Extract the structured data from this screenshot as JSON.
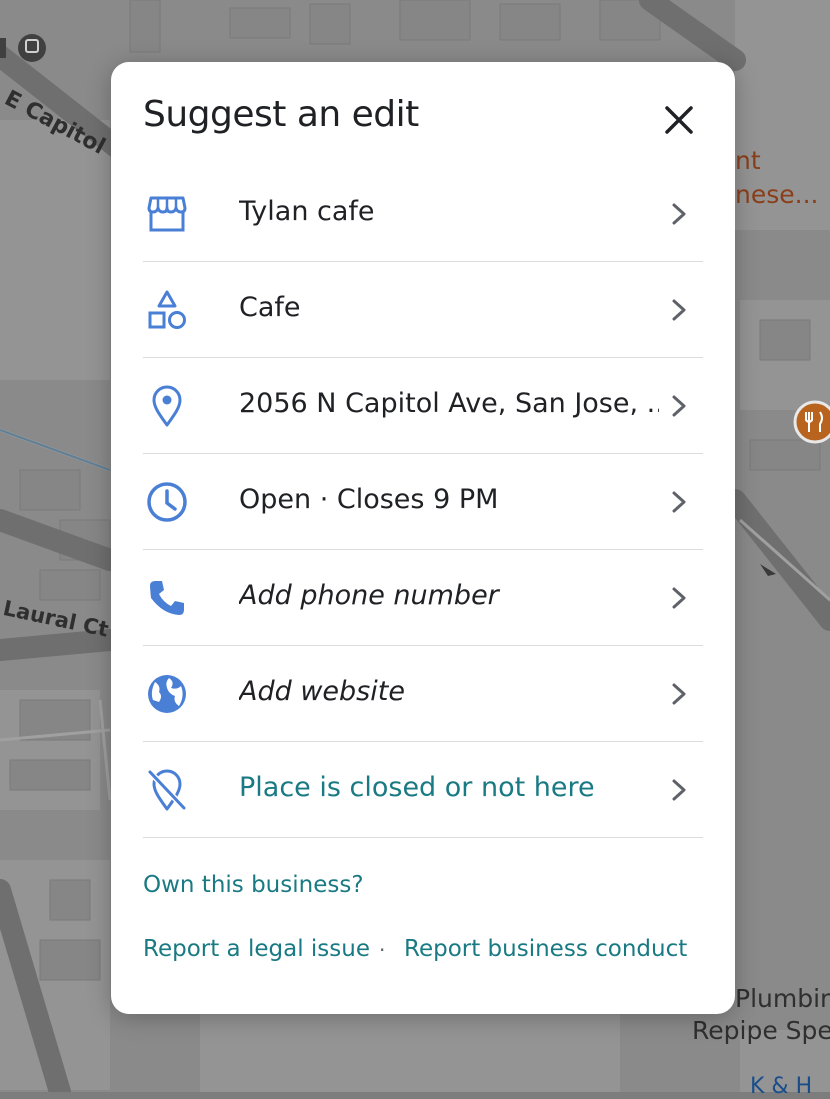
{
  "map": {
    "labels": {
      "street_top": "E Capitol",
      "laural": "Laural Ct",
      "partial_right_1": "nt",
      "partial_right_2": "nese...",
      "plumbing_1": "Plumbin",
      "plumbing_2": "Repipe Spe",
      "partial_bottom": "K & H"
    },
    "icons": {
      "transit": "train-icon",
      "restaurant": "fork-knife-icon"
    }
  },
  "dialog": {
    "title": "Suggest an edit",
    "close_icon": "close-icon",
    "rows": [
      {
        "icon": "storefront-icon",
        "label": "Tylan cafe"
      },
      {
        "icon": "category-shapes-icon",
        "label": "Cafe"
      },
      {
        "icon": "location-pin-icon",
        "label": "2056 N Capitol Ave, San Jose, ..."
      },
      {
        "icon": "clock-icon",
        "label": "Open · Closes 9 PM"
      },
      {
        "icon": "phone-icon",
        "label": "Add phone number"
      },
      {
        "icon": "globe-icon",
        "label": "Add website"
      },
      {
        "icon": "location-off-icon",
        "label": "Place is closed or not here"
      }
    ],
    "links": {
      "own_business": "Own this business?",
      "report_legal": "Report a legal issue",
      "separator": "·",
      "report_conduct": "Report business conduct"
    }
  },
  "colors": {
    "accent_blue": "#4a7fd6",
    "link_teal": "#1a7a83",
    "text_dark": "#202124",
    "divider": "#dadce0",
    "map_dim": "#7d7d7d"
  }
}
